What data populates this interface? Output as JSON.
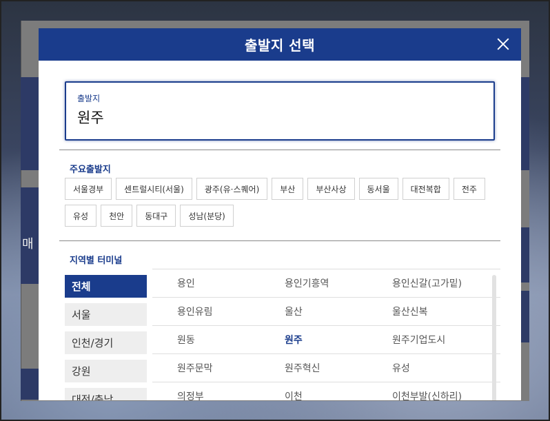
{
  "modal": {
    "title": "출발지 선택"
  },
  "origin": {
    "label": "출발지",
    "value": "원주"
  },
  "major": {
    "title": "주요출발지",
    "items": [
      "서울경부",
      "센트럴시티(서울)",
      "광주(유·스퀘어)",
      "부산",
      "부산사상",
      "동서울",
      "대전복합",
      "전주",
      "유성",
      "천안",
      "동대구",
      "성남(분당)"
    ]
  },
  "regional": {
    "title": "지역별 터미널",
    "regions": [
      "전체",
      "서울",
      "인천/경기",
      "강원",
      "대전/충남"
    ],
    "active_region": "전체",
    "terminals": [
      [
        "용인",
        "용인기흥역",
        "용인신갈(고가밑)"
      ],
      [
        "용인유림",
        "울산",
        "울산신복"
      ],
      [
        "원동",
        "원주",
        "원주기업도시"
      ],
      [
        "원주문막",
        "원주혁신",
        "유성"
      ],
      [
        "의정부",
        "이천",
        "이천부발(신하리)"
      ]
    ],
    "selected_terminal": "원주"
  },
  "background": {
    "left_text": "매"
  },
  "colors": {
    "brand": "#1a3c8c"
  }
}
